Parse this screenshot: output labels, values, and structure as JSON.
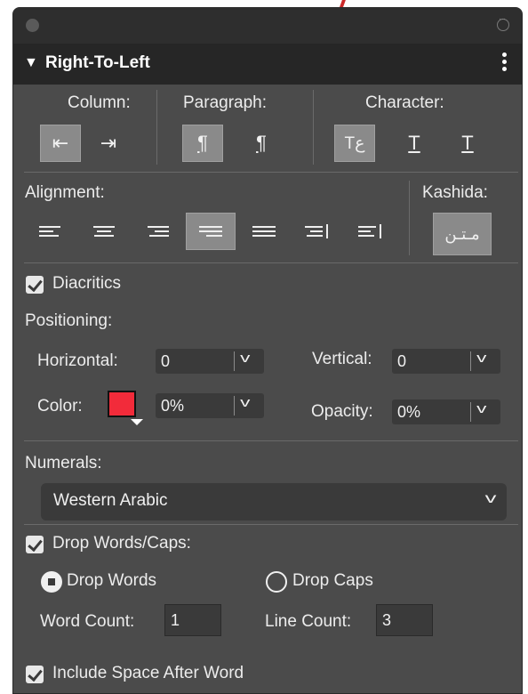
{
  "panel": {
    "title": "Right-To-Left",
    "collapse_icon": "triangle-down-icon",
    "menu_icon": "kebab-menu-icon"
  },
  "direction": {
    "column_label": "Column:",
    "paragraph_label": "Paragraph:",
    "character_label": "Character:",
    "column_buttons": [
      {
        "icon": "column-rtl-icon",
        "glyph": "⇤",
        "selected": true
      },
      {
        "icon": "column-ltr-icon",
        "glyph": "⇥",
        "selected": false
      }
    ],
    "paragraph_buttons": [
      {
        "icon": "paragraph-rtl-icon",
        "glyph": "¶",
        "selected": true
      },
      {
        "icon": "paragraph-ltr-icon",
        "glyph": "¶",
        "selected": false
      }
    ],
    "character_buttons": [
      {
        "icon": "character-mixed-icon",
        "glyph": "Tع",
        "selected": true
      },
      {
        "icon": "character-rtl-icon",
        "glyph": "T",
        "selected": false
      },
      {
        "icon": "character-ltr-icon",
        "glyph": "T",
        "selected": false
      }
    ]
  },
  "alignment": {
    "label": "Alignment:",
    "kashida_label": "Kashida:",
    "kashida_glyph": "مـتـن",
    "buttons": [
      {
        "icon": "align-left-icon",
        "selected": false
      },
      {
        "icon": "align-center-icon",
        "selected": false
      },
      {
        "icon": "align-right-icon",
        "selected": false
      },
      {
        "icon": "justify-right-icon",
        "selected": true
      },
      {
        "icon": "justify-all-icon",
        "selected": false
      },
      {
        "icon": "align-right-edge-icon",
        "selected": false
      },
      {
        "icon": "align-left-edge-icon",
        "selected": false
      }
    ]
  },
  "diacritics": {
    "label": "Diacritics",
    "checked": true,
    "positioning_label": "Positioning:",
    "horizontal_label": "Horizontal:",
    "horizontal_value": "0",
    "vertical_label": "Vertical:",
    "vertical_value": "0",
    "color_label": "Color:",
    "color_swatch": "#f22b3a",
    "color_percent": "0%",
    "opacity_label": "Opacity:",
    "opacity_value": "0%"
  },
  "numerals": {
    "label": "Numerals:",
    "selected": "Western Arabic"
  },
  "drop": {
    "label": "Drop Words/Caps:",
    "checked": true,
    "drop_words_label": "Drop Words",
    "drop_caps_label": "Drop Caps",
    "selected": "Drop Words",
    "word_count_label": "Word Count:",
    "word_count_value": "1",
    "line_count_label": "Line Count:",
    "line_count_value": "3",
    "include_space_label": "Include Space After Word",
    "include_space_checked": true
  },
  "colors": {
    "panel_bg": "#4b4b4b",
    "header_bg": "#262626",
    "selected_button": "#8a8a8a",
    "accent_red": "#f22b3a"
  }
}
